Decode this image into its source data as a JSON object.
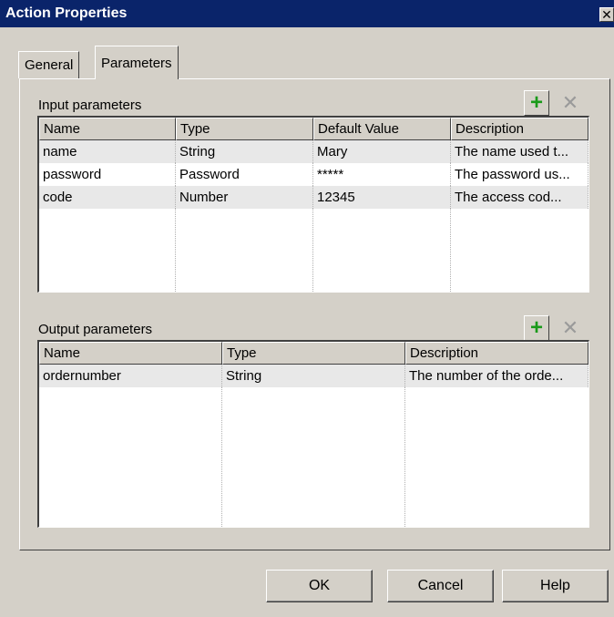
{
  "dialog": {
    "title": "Action Properties",
    "close_glyph": "✕"
  },
  "tabs": [
    {
      "label": "General"
    },
    {
      "label": "Parameters"
    }
  ],
  "input_parameters": {
    "label": "Input parameters",
    "add_icon": "plus-icon",
    "delete_icon": "delete-x-icon",
    "add_glyph": "+",
    "delete_glyph": "✕",
    "columns": [
      "Name",
      "Type",
      "Default Value",
      "Description"
    ],
    "rows": [
      {
        "name": "name",
        "type": "String",
        "default_value": "Mary",
        "description": "The name used t..."
      },
      {
        "name": "password",
        "type": "Password",
        "default_value": "*****",
        "description": "The password us..."
      },
      {
        "name": "code",
        "type": "Number",
        "default_value": "12345",
        "description": "The access cod..."
      }
    ]
  },
  "output_parameters": {
    "label": "Output parameters",
    "add_icon": "plus-icon",
    "delete_icon": "delete-x-icon",
    "add_glyph": "+",
    "delete_glyph": "✕",
    "columns": [
      "Name",
      "Type",
      "Description"
    ],
    "rows": [
      {
        "name": "ordernumber",
        "type": "String",
        "description": "The number of the orde..."
      }
    ]
  },
  "buttons": {
    "ok": "OK",
    "cancel": "Cancel",
    "help": "Help"
  },
  "colors": {
    "titlebar": "#0a246a",
    "dialog_bg": "#d4d0c8",
    "add_icon": "#1a9a1a",
    "delete_icon": "#9a9a9a"
  }
}
